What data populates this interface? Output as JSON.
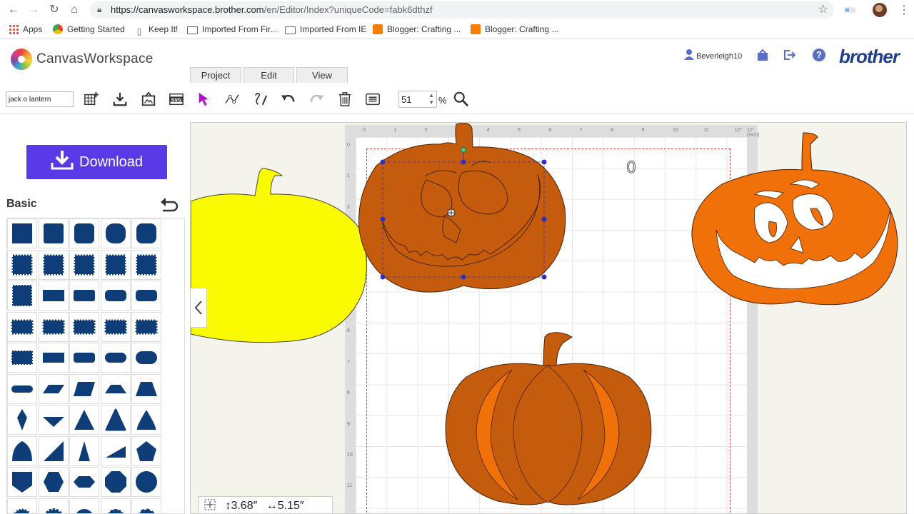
{
  "browser": {
    "url": "https://canvasworkspace.brother.com/en/Editor/Index?uniqueCode=fabk6dthzf",
    "url_host": "https://canvasworkspace.brother.com",
    "url_path": "/en/Editor/Index?uniqueCode=fabk6dthzf",
    "bookmarks": [
      {
        "label": "Apps",
        "icon": "apps-icon"
      },
      {
        "label": "Getting Started",
        "icon": "chrome-icon"
      },
      {
        "label": "Keep It!",
        "icon": "keep-icon"
      },
      {
        "label": "Imported From Fir...",
        "icon": "folder-icon"
      },
      {
        "label": "Imported From IE",
        "icon": "folder-icon"
      },
      {
        "label": "Blogger: Crafting ...",
        "icon": "blogger-icon"
      },
      {
        "label": "Blogger: Crafting ...",
        "icon": "blogger-icon"
      }
    ]
  },
  "app": {
    "logo_text": "CanvasWorkspace",
    "brand": "brother",
    "username": "Beverleigh10",
    "tabs": [
      "Project",
      "Edit",
      "View"
    ],
    "project_name": "jack o lantern",
    "zoom_value": "51",
    "zoom_unit": "%"
  },
  "left_panel": {
    "download_label": "Download",
    "section_title": "Basic"
  },
  "canvas": {
    "mat_unit": "12\" (inch)",
    "text_glyph": "0",
    "ruler_top": [
      "0",
      "1",
      "2",
      "3",
      "4",
      "5",
      "6",
      "7",
      "8",
      "9",
      "10",
      "11",
      "12\""
    ],
    "ruler_left": [
      "0",
      "1",
      "2",
      "3",
      "4",
      "5",
      "6",
      "7",
      "8",
      "9",
      "10",
      "11"
    ],
    "selection_width": "↕3.68″",
    "selection_height": "↔5.15″"
  },
  "colors": {
    "download_bg": "#5a39e6",
    "shape_fill": "#0f3d78",
    "pumpkin_dark": "#c55b0c",
    "pumpkin_bright": "#f0700a",
    "pumpkin_yellow": "#fafa00",
    "selection": "#3030c0"
  }
}
